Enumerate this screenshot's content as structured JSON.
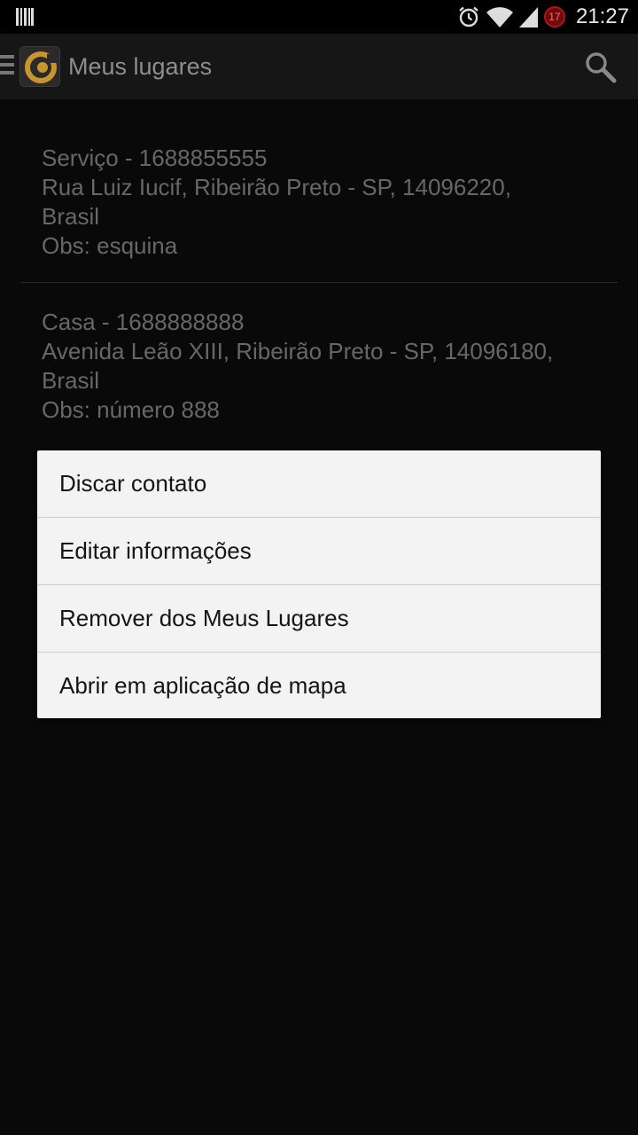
{
  "status_bar": {
    "time": "21:27",
    "badge_count": "17",
    "icons": [
      "barcode-icon",
      "alarm-icon",
      "wifi-icon",
      "signal-icon",
      "notification-badge-icon"
    ]
  },
  "action_bar": {
    "title": "Meus lugares",
    "icons": [
      "drawer-menu-icon",
      "app-logo-icon",
      "search-icon"
    ]
  },
  "places": [
    {
      "name_line": "Serviço  - 1688855555",
      "address_line1": "Rua Luiz Iucif, Ribeirão Preto - SP, 14096220,",
      "address_line2": "Brasil",
      "obs": "Obs: esquina"
    },
    {
      "name_line": "Casa - 1688888888",
      "address_line1": "Avenida Leão XIII, Ribeirão Preto - SP, 14096180,",
      "address_line2": "Brasil",
      "obs": "Obs: número 888"
    }
  ],
  "context_menu": {
    "items": [
      "Discar contato",
      "Editar informações",
      "Remover dos Meus Lugares",
      "Abrir em aplicação de mapa"
    ]
  },
  "colors": {
    "background": "#0d0d0d",
    "action_bar": "#161616",
    "list_text": "#8a8a8a",
    "menu_background": "#f3f3f3",
    "logo_accent": "#c8962e",
    "badge_red": "#b01515"
  }
}
